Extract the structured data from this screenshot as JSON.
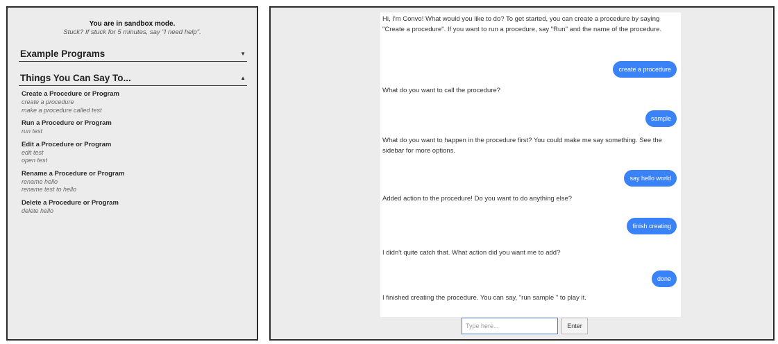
{
  "sidebar": {
    "mode_title": "You are in sandbox mode.",
    "mode_hint": "Stuck? If stuck for 5 minutes, say \"I need help\".",
    "example_programs": {
      "label": "Example Programs",
      "chevron": "▼"
    },
    "things_you_can_say": {
      "label": "Things You Can Say To...",
      "chevron": "▲",
      "commands": [
        {
          "title": "Create a Procedure or Program",
          "examples": [
            "create a procedure",
            "make a procedure called test"
          ]
        },
        {
          "title": "Run a Procedure or Program",
          "examples": [
            "run test"
          ]
        },
        {
          "title": "Edit a Procedure or Program",
          "examples": [
            "edit test",
            "open test"
          ]
        },
        {
          "title": "Rename a Procedure or Program",
          "examples": [
            "rename hello",
            "rename test to hello"
          ]
        },
        {
          "title": "Delete a Procedure or Program",
          "examples": [
            "delete hello"
          ]
        }
      ]
    }
  },
  "chat": {
    "messages": [
      {
        "from": "bot",
        "text": "Hi, I'm Convo! What would you like to do? To get started, you can create a procedure by saying \"Create a procedure\". If you want to run a procedure, say \"Run\" and the name of the procedure."
      },
      {
        "from": "user",
        "text": "create a procedure"
      },
      {
        "from": "bot",
        "text": "What do you want to call the procedure?"
      },
      {
        "from": "user",
        "text": "sample"
      },
      {
        "from": "bot",
        "text": "What do you want to happen in the procedure first? You could make me say something. See the sidebar for more options."
      },
      {
        "from": "user",
        "text": "say hello world"
      },
      {
        "from": "bot",
        "text": "Added action to the procedure! Do you want to do anything else?"
      },
      {
        "from": "user",
        "text": "finish creating"
      },
      {
        "from": "bot",
        "text": "I didn't quite catch that. What action did you want me to add?"
      },
      {
        "from": "user",
        "text": "done"
      },
      {
        "from": "bot",
        "text": "I finished creating the procedure. You can say, \"run sample \" to play it."
      }
    ],
    "input_placeholder": "Type here...",
    "enter_label": "Enter"
  },
  "colors": {
    "user_bubble": "#3a82f7",
    "panel_bg": "#ececec",
    "input_border": "#4a7fd9"
  }
}
